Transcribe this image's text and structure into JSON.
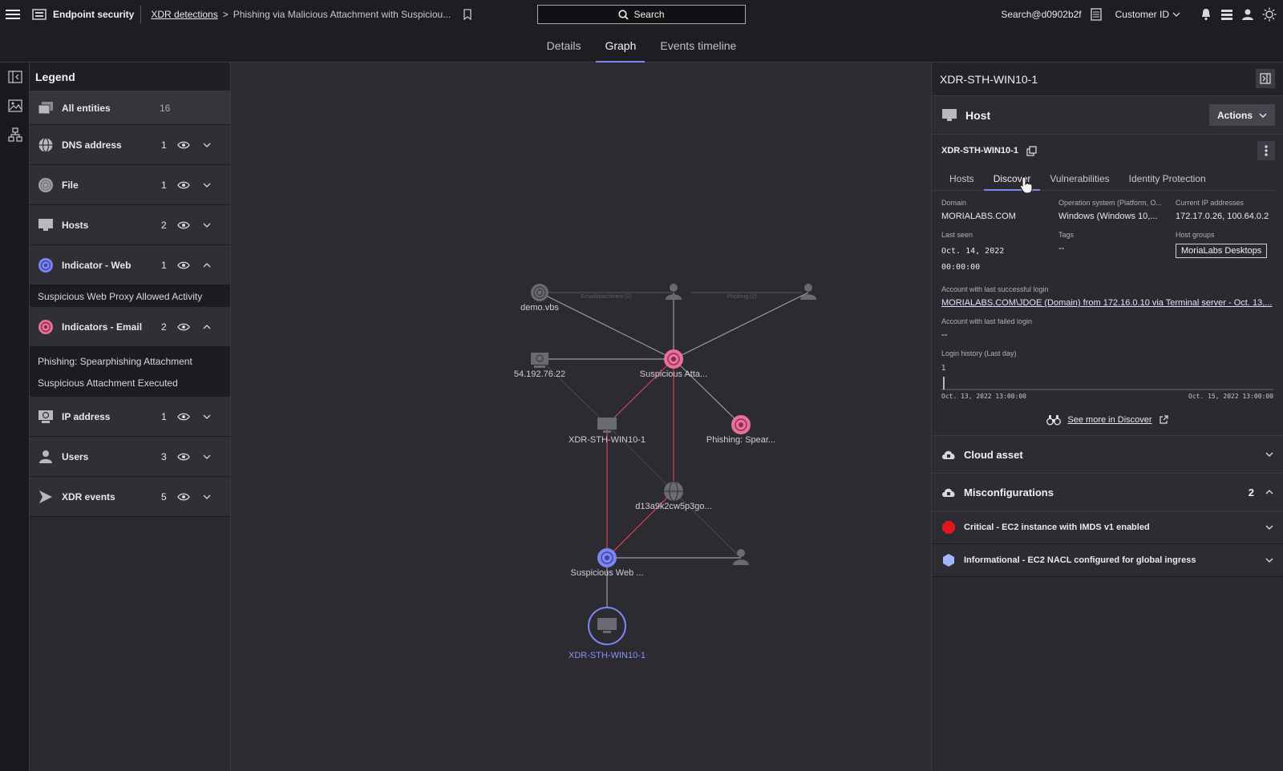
{
  "topbar": {
    "app_name": "Endpoint security",
    "breadcrumb_link": "XDR detections",
    "breadcrumb_sep": ">",
    "breadcrumb_current": "Phishing via Malicious Attachment with Suspiciou...",
    "search_label": "Search",
    "user": "Search@d0902b2f",
    "customer": "Customer ID"
  },
  "tabs": [
    {
      "label": "Details"
    },
    {
      "label": "Graph",
      "active": true
    },
    {
      "label": "Events timeline"
    }
  ],
  "legend": {
    "title": "Legend",
    "all": {
      "label": "All entities",
      "count": "16"
    },
    "items": [
      {
        "label": "DNS address",
        "count": "1",
        "icon": "globe-icon"
      },
      {
        "label": "File",
        "count": "1",
        "icon": "fingerprint-icon"
      },
      {
        "label": "Hosts",
        "count": "2",
        "icon": "monitor-icon"
      },
      {
        "label": "Indicator - Web",
        "count": "1",
        "icon": "web-indicator-icon"
      },
      {
        "label": "Indicators - Email",
        "count": "2",
        "icon": "email-indicator-icon"
      },
      {
        "label": "IP address",
        "count": "1",
        "icon": "ip-icon"
      },
      {
        "label": "Users",
        "count": "3",
        "icon": "user-icon"
      },
      {
        "label": "XDR events",
        "count": "5",
        "icon": "xdr-event-icon"
      }
    ],
    "web_sub": [
      "Suspicious Web Proxy Allowed Activity"
    ],
    "email_sub": [
      "Phishing: Spearphishing Attachment",
      "Suspicious Attachment Executed"
    ]
  },
  "graph": {
    "nodes": {
      "demo": "demo.vbs",
      "ip": "54.192.76.22",
      "susp_att": "Suspicious Atta...",
      "host1": "XDR-STH-WIN10-1",
      "phish": "Phishing: Spear...",
      "dns": "d13a9k2cw5p3go...",
      "susp_web": "Suspicious Web ...",
      "host2": "XDR-STH-WIN10-1"
    },
    "edges": {
      "e1": "EmailAttachment (2)",
      "e2": "Phishing (2)"
    }
  },
  "panel": {
    "title": "XDR-STH-WIN10-1",
    "section": "Host",
    "actions_label": "Actions",
    "hostname": "XDR-STH-WIN10-1",
    "subtabs": [
      "Hosts",
      "Discover",
      "Vulnerabilities",
      "Identity Protection"
    ],
    "fields": {
      "domain_label": "Domain",
      "domain": "MORIALABS.COM",
      "os_label": "Operation system (Platform, O...",
      "os": "Windows (Windows 10,...",
      "ip_label": "Current IP addresses",
      "ip": "172.17.0.26, 100.64.0.2",
      "last_seen_label": "Last seen",
      "last_seen_date": "Oct. 14, 2022",
      "last_seen_time": "00:00:00",
      "tags_label": "Tags",
      "tags": "--",
      "groups_label": "Host groups",
      "group": "MoriaLabs Desktops",
      "success_label": "Account with last successful login",
      "success": "MORIALABS.COM\\JDOE (Domain) from 172.16.0.10 via Terminal server - Oct. 13,...",
      "failed_label": "Account with last failed login",
      "failed": "--",
      "history_label": "Login history (Last day)",
      "history_y": "1",
      "history_start": "Oct. 13, 2022 13:00:00",
      "history_end": "Oct. 15, 2022 13:00:00"
    },
    "see_more": "See more in Discover",
    "cloud": "Cloud asset",
    "misconf": "Misconfigurations",
    "misconf_count": "2",
    "misconf_items": [
      {
        "label": "Critical - EC2 instance with IMDS v1 enabled",
        "color": "#e0161f"
      },
      {
        "label": "Informational - EC2 NACL configured for global ingress",
        "color": "#9fb7ff"
      }
    ]
  }
}
